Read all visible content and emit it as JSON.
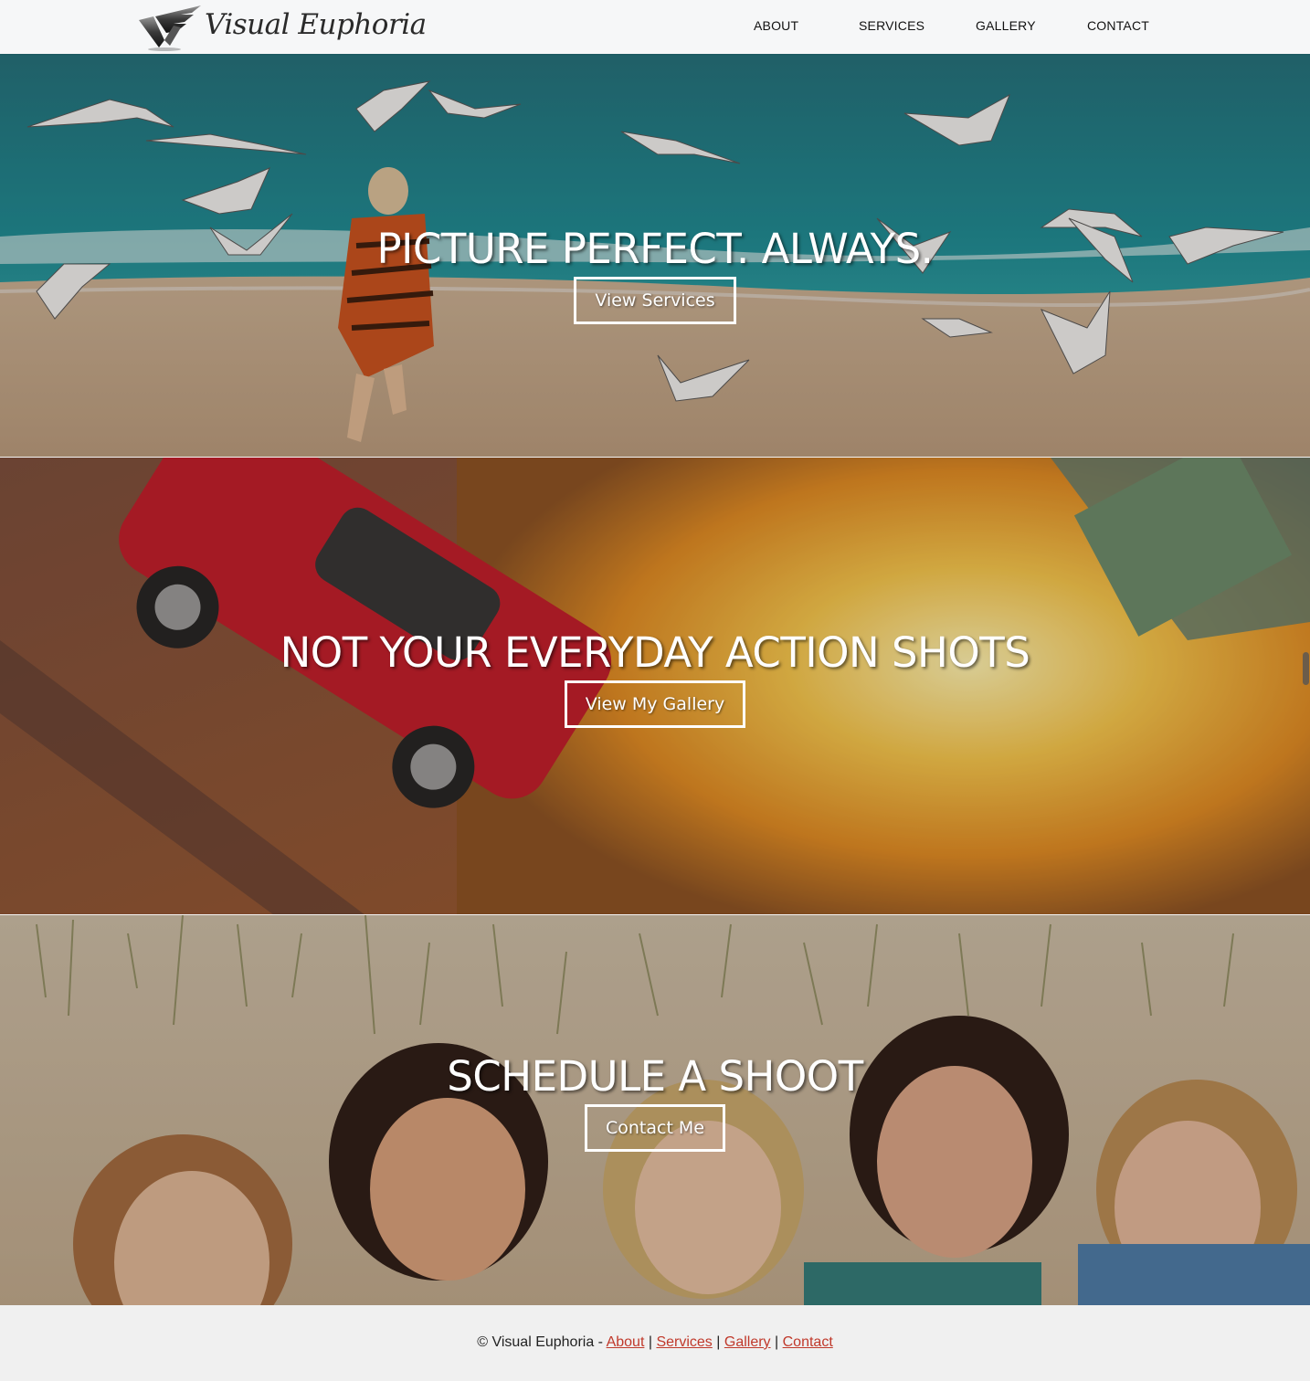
{
  "header": {
    "logo_text": "Visual Euphoria",
    "nav": [
      {
        "label": "ABOUT"
      },
      {
        "label": "SERVICES"
      },
      {
        "label": "GALLERY"
      },
      {
        "label": "CONTACT"
      }
    ]
  },
  "sections": [
    {
      "heading": "PICTURE PERFECT. ALWAYS.",
      "button": "View Services"
    },
    {
      "heading": "NOT YOUR EVERYDAY ACTION SHOTS",
      "button": "View My Gallery"
    },
    {
      "heading": "SCHEDULE A SHOOT",
      "button": "Contact Me"
    }
  ],
  "footer": {
    "copyright": "© Visual Euphoria -",
    "links": [
      "About",
      "Services",
      "Gallery",
      "Contact"
    ],
    "separator": "|"
  },
  "colors": {
    "header_bg": "#f6f7f8",
    "footer_link": "#c0392b",
    "footer_bg": "#f0f0f0"
  }
}
